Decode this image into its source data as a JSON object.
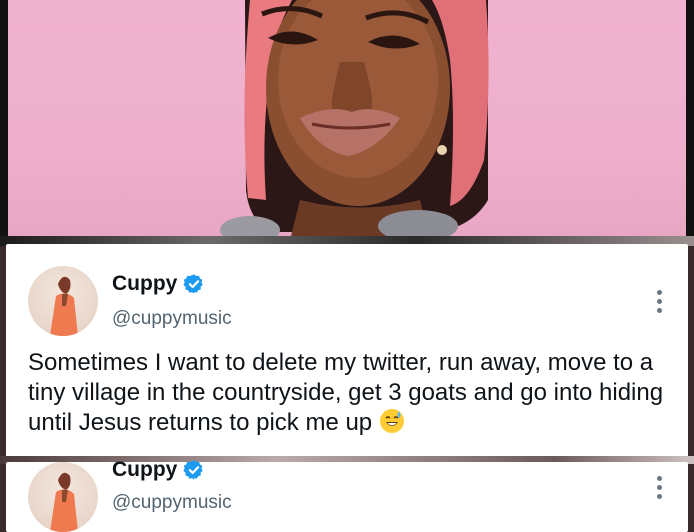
{
  "tweet": {
    "author_name": "Cuppy",
    "handle": "@cuppymusic",
    "text": "Sometimes I want to delete my twitter, run away, move to a tiny village in the countryside, get 3 goats and go into hiding until Jesus returns to pick me up",
    "emoji": "sweat-smile-emoji",
    "verified_color": "#1d9bf0"
  },
  "reply": {
    "author_name": "Cuppy",
    "handle": "@cuppymusic"
  },
  "colors": {
    "background_pink": "#eeb0cc",
    "text_primary": "#0f1419",
    "text_secondary": "#536471"
  }
}
